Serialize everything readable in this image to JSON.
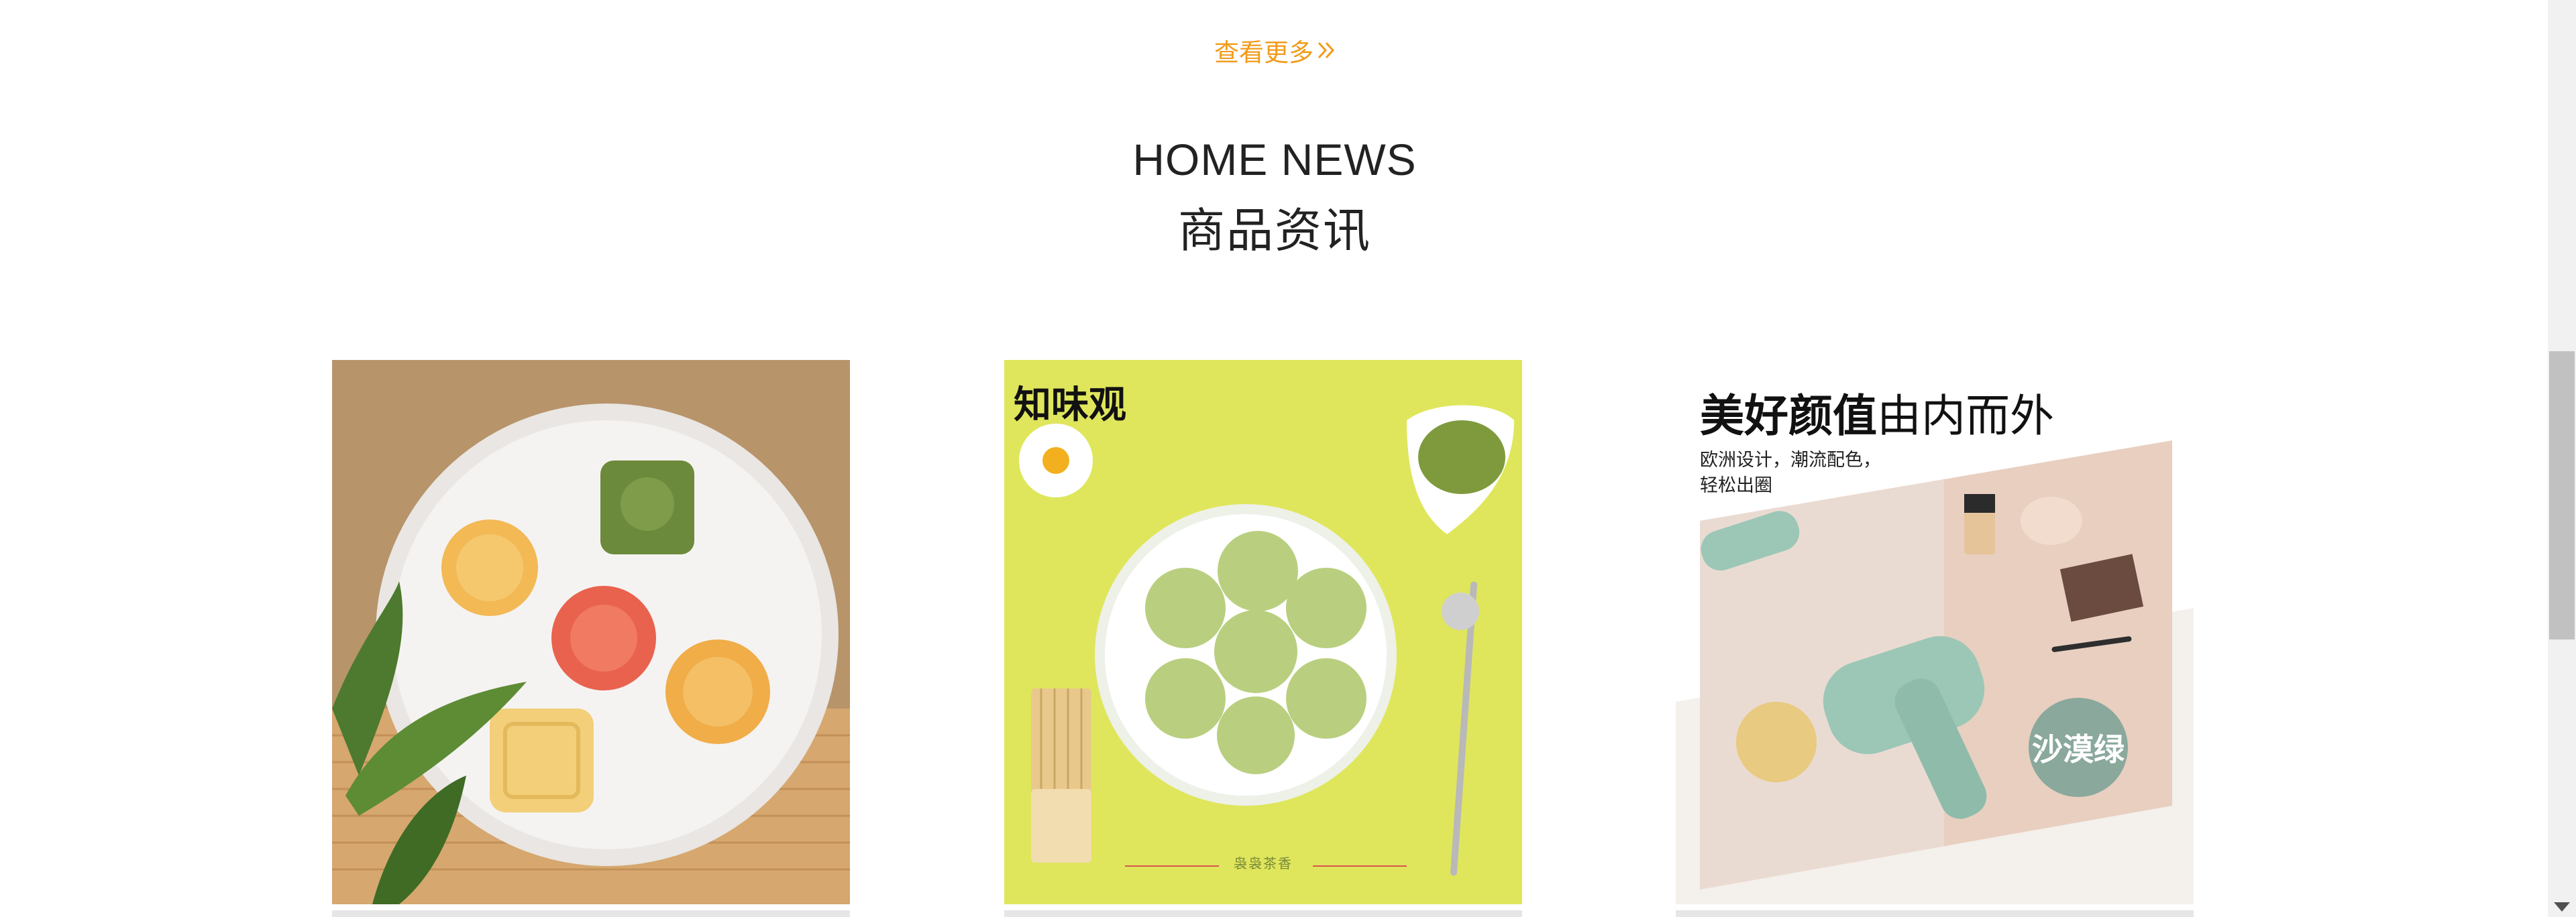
{
  "more_link": {
    "label": "查看更多"
  },
  "news_section": {
    "title_en": "HOME NEWS",
    "title_cn": "商品资讯"
  },
  "cards": [
    {
      "name": "mooncake-plate"
    },
    {
      "name": "matcha-cakes",
      "logo_text": "知味观",
      "footer_text": "袅袅茶香"
    },
    {
      "name": "hair-dryer",
      "title_bold": "美好颜值",
      "title_normal": "由内而外",
      "desc_line1": "欧洲设计，潮流配色，",
      "desc_line2": "轻松出圈",
      "badge": "沙漠绿"
    }
  ],
  "colors": {
    "accent": "#f29b1a",
    "heading": "#222222",
    "matcha_bg": "#dfe65c",
    "dryer_green": "#9cc7b6"
  }
}
